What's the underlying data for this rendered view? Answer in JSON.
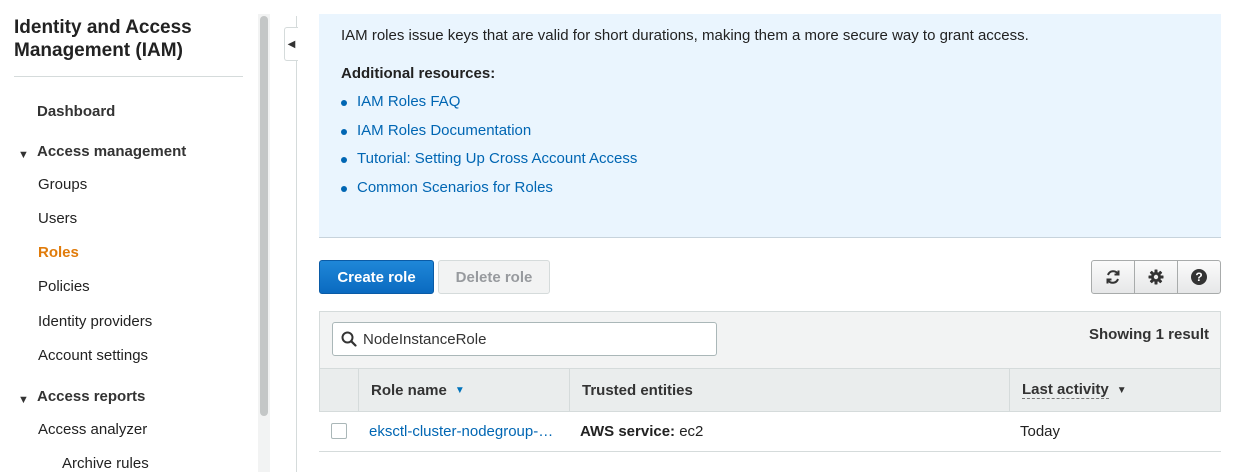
{
  "sidebar": {
    "title": "Identity and Access Management (IAM)",
    "dashboard": "Dashboard",
    "access_management": {
      "label": "Access management",
      "items": [
        "Groups",
        "Users",
        "Roles",
        "Policies",
        "Identity providers",
        "Account settings"
      ],
      "active": "Roles"
    },
    "access_reports": {
      "label": "Access reports",
      "items": [
        "Access analyzer"
      ],
      "sub_items": [
        "Archive rules"
      ]
    }
  },
  "info": {
    "description": "IAM roles issue keys that are valid for short durations, making them a more secure way to grant access.",
    "resources_heading": "Additional resources:",
    "resources": [
      "IAM Roles FAQ",
      "IAM Roles Documentation",
      "Tutorial: Setting Up Cross Account Access",
      "Common Scenarios for Roles"
    ]
  },
  "toolbar": {
    "create_label": "Create role",
    "delete_label": "Delete role",
    "icons": [
      "refresh-icon",
      "gear-icon",
      "help-icon"
    ]
  },
  "table": {
    "search_value": "NodeInstanceRole",
    "showing": "Showing 1 result",
    "columns": [
      "Role name",
      "Trusted entities",
      "Last activity"
    ],
    "rows": [
      {
        "role_name": "eksctl-cluster-nodegroup-ng-NodeInstanceRole",
        "trusted_label": "AWS service:",
        "trusted_value": "ec2",
        "last_activity": "Today"
      }
    ]
  },
  "colors": {
    "accent": "#0066b3",
    "active_nav": "#e07b0a",
    "primary_button": "#0a6ac0",
    "info_bg": "#eaf5fe"
  }
}
